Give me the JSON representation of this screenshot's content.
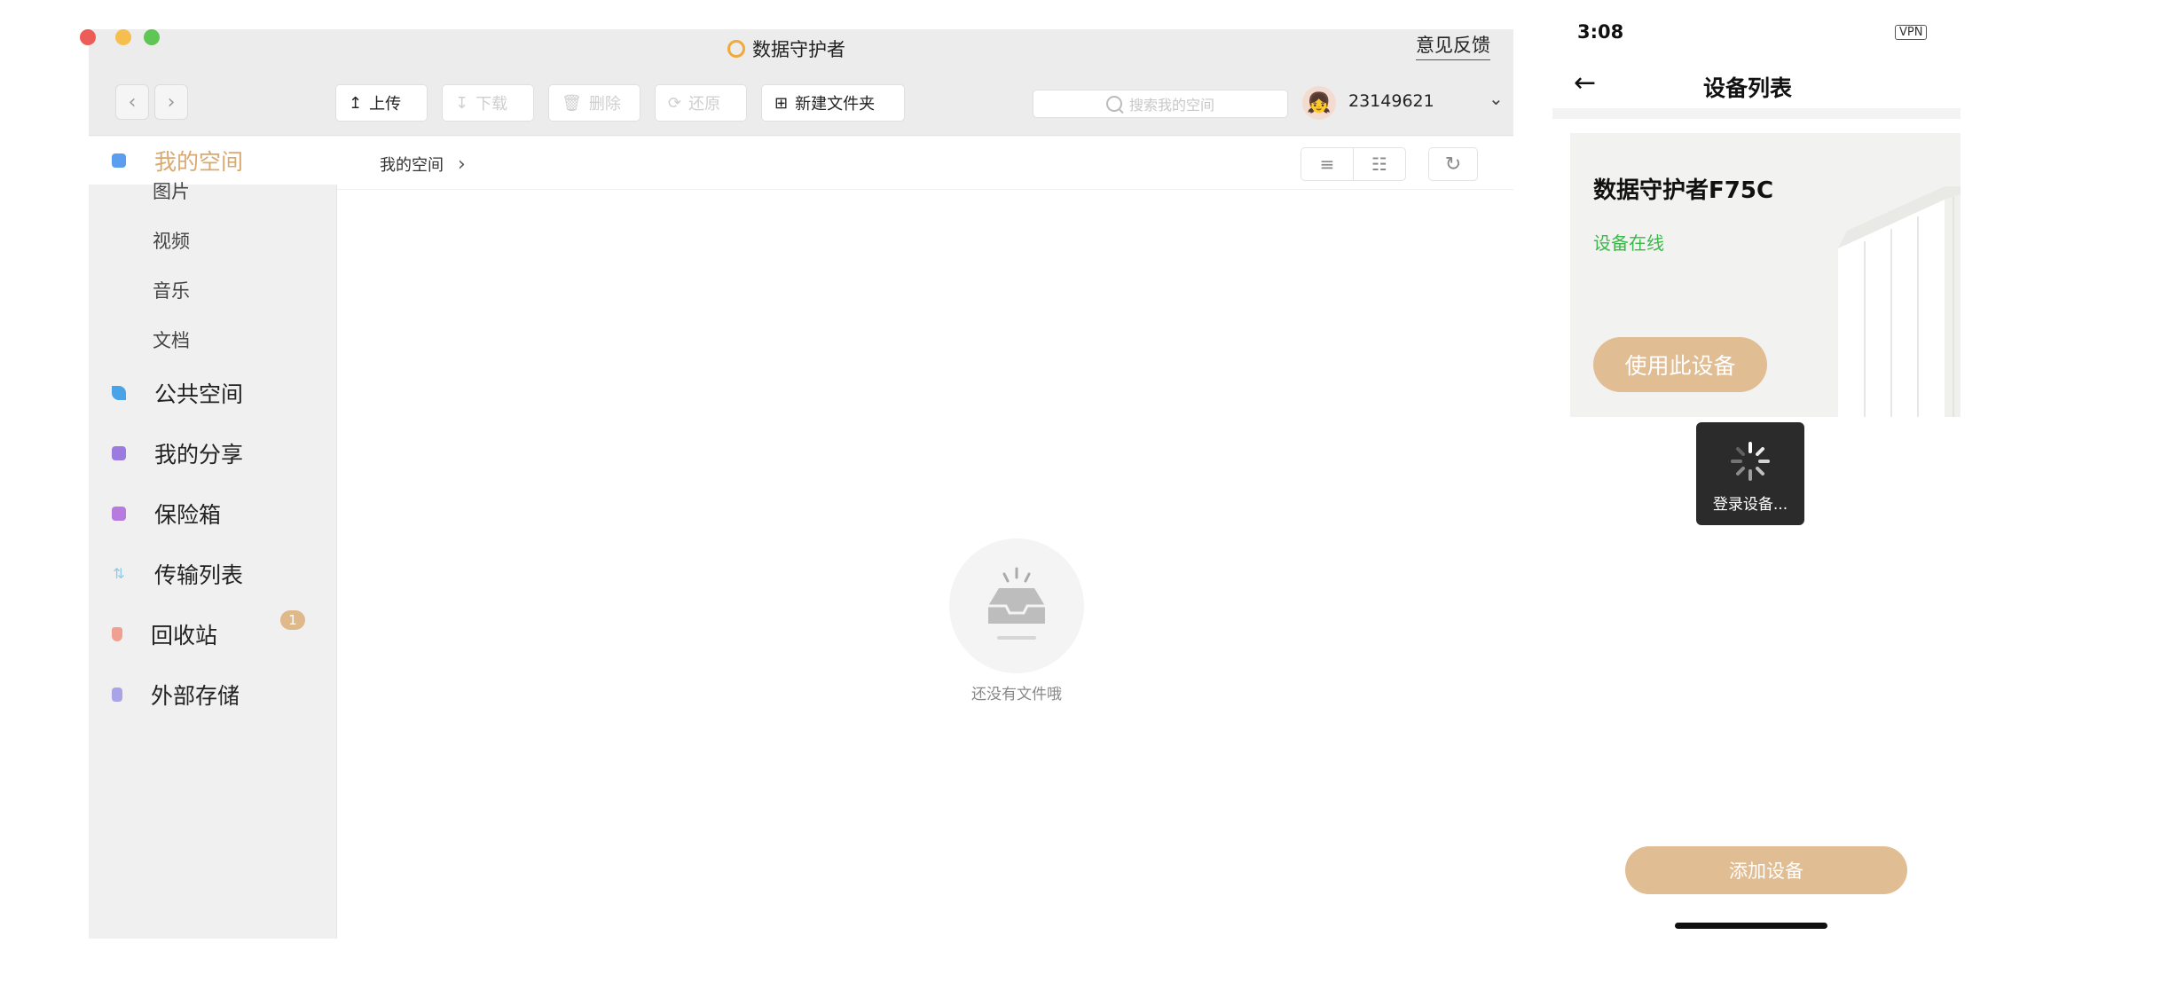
{
  "desktop": {
    "title": "数据守护者",
    "feedback_link": "意见反馈",
    "toolbar": {
      "upload_label": "上传",
      "download_label": "下载",
      "delete_label": "删除",
      "restore_label": "还原",
      "new_folder_label": "新建文件夹"
    },
    "search": {
      "placeholder": "搜索我的空间"
    },
    "user": {
      "name": "23149621"
    },
    "sidebar": {
      "items": [
        {
          "label": "我的空间",
          "color": "#d9a96f"
        },
        {
          "label": "公共空间",
          "color": "#4aa3e6"
        },
        {
          "label": "我的分享",
          "color": "#9b7be0"
        },
        {
          "label": "保险箱",
          "color": "#b77be0"
        },
        {
          "label": "传输列表",
          "color": "#8fcbe8"
        },
        {
          "label": "回收站",
          "color": "#f0a090"
        },
        {
          "label": "外部存储",
          "color": "#a9a3e8"
        }
      ],
      "sub_items": [
        "图片",
        "视频",
        "音乐",
        "文档"
      ],
      "transfer_badge": "1"
    },
    "breadcrumb": {
      "root": "我的空间"
    },
    "empty_state": {
      "text": "还没有文件哦"
    }
  },
  "phone": {
    "status": {
      "time": "3:08",
      "vpn": "VPN"
    },
    "nav": {
      "title": "设备列表"
    },
    "device": {
      "name": "数据守护者F75C",
      "status": "设备在线",
      "use_button": "使用此设备"
    },
    "toast": {
      "text": "登录设备..."
    },
    "add_button": "添加设备"
  },
  "colors": {
    "accent": "#e1bd93",
    "active_text": "#d9a96f",
    "online_green": "#3bb84a",
    "app_logo": "#f2a93b"
  }
}
